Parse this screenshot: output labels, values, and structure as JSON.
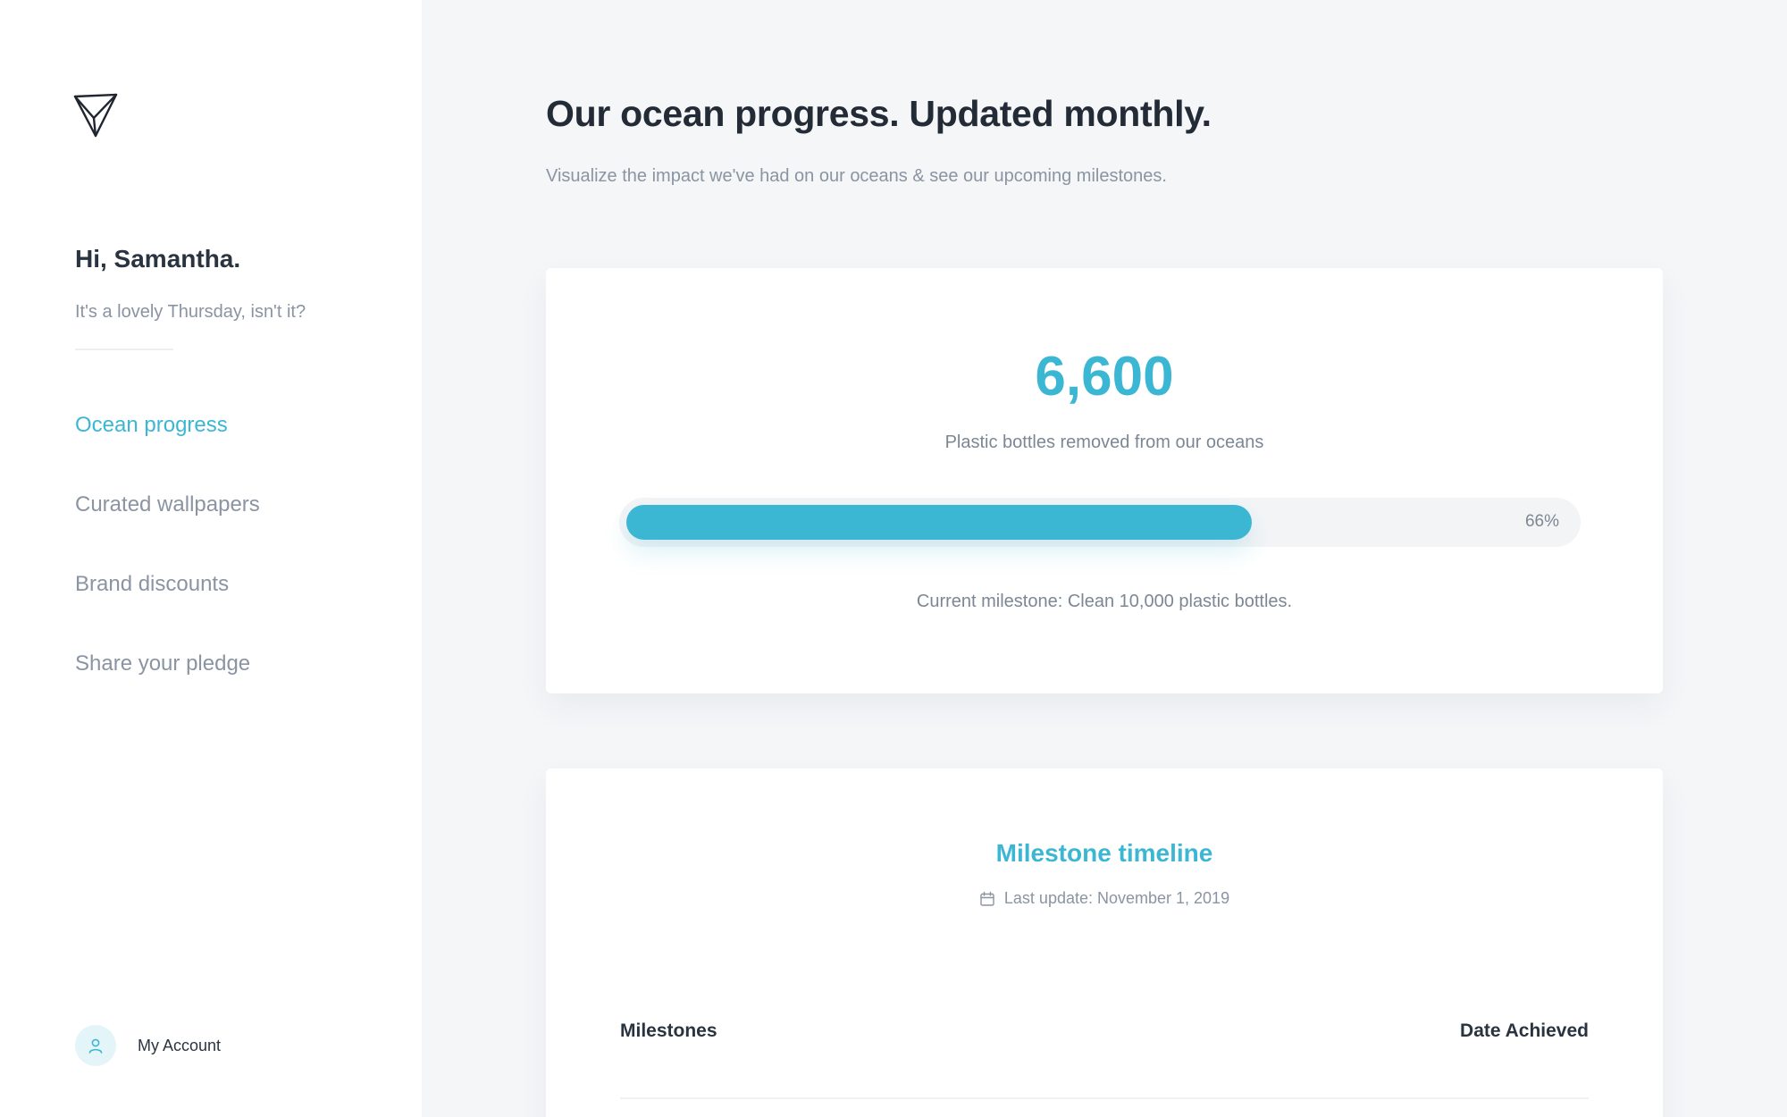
{
  "sidebar": {
    "logo_icon": "paper-plane-logo",
    "greeting": "Hi, Samantha.",
    "subgreeting": "It's a lovely Thursday, isn't it?",
    "nav": [
      {
        "label": "Ocean progress",
        "active": true
      },
      {
        "label": "Curated wallpapers",
        "active": false
      },
      {
        "label": "Brand discounts",
        "active": false
      },
      {
        "label": "Share your pledge",
        "active": false
      }
    ],
    "account": {
      "label": "My Account",
      "icon": "user-icon"
    }
  },
  "header": {
    "title": "Our ocean progress. Updated monthly.",
    "subtitle": "Visualize the impact we've had on our oceans & see our upcoming milestones."
  },
  "progress_card": {
    "value": "6,600",
    "label": "Plastic bottles removed from our oceans",
    "progress_percent": 66,
    "progress_label": "66%",
    "milestone": "Current milestone: Clean 10,000 plastic bottles."
  },
  "timeline_card": {
    "title": "Milestone timeline",
    "last_update_icon": "calendar-icon",
    "last_update": "Last update: November 1, 2019",
    "columns": [
      "Milestones",
      "Date Achieved"
    ]
  },
  "colors": {
    "accent": "#3bb7d3",
    "text_dark": "#2a3441",
    "text_muted": "#8a94a2",
    "background": "#f5f6f8"
  }
}
